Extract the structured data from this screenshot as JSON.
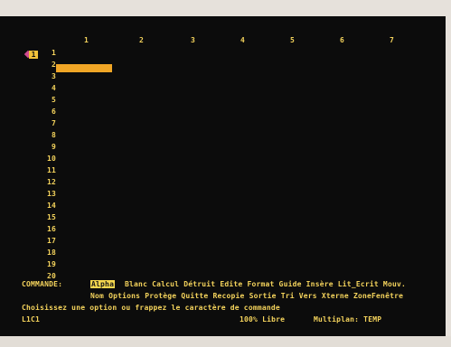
{
  "sheet": {
    "corner_label": "1",
    "columns": [
      "1",
      "2",
      "3",
      "4",
      "5",
      "6",
      "7"
    ],
    "rows": [
      "1",
      "2",
      "3",
      "4",
      "5",
      "6",
      "7",
      "8",
      "9",
      "10",
      "11",
      "12",
      "13",
      "14",
      "15",
      "16",
      "17",
      "18",
      "19",
      "20"
    ]
  },
  "command_bar": {
    "label": "COMMANDE:",
    "selected_option": "Alpha",
    "options_line1": "Blanc Calcul Détruit Edite Format Guide Insère Lit_Ecrit Mouv.",
    "options_line2": "Nom Options Protège Quitte Recopie Sortie Tri Vers Xterne ZoneFenêtre"
  },
  "status": {
    "prompt": "Choisissez une option ou frappez le caractère de commande",
    "cell_reference": "L1C1",
    "memory": "100% Libre",
    "file_info": "Multiplan: TEMP"
  }
}
